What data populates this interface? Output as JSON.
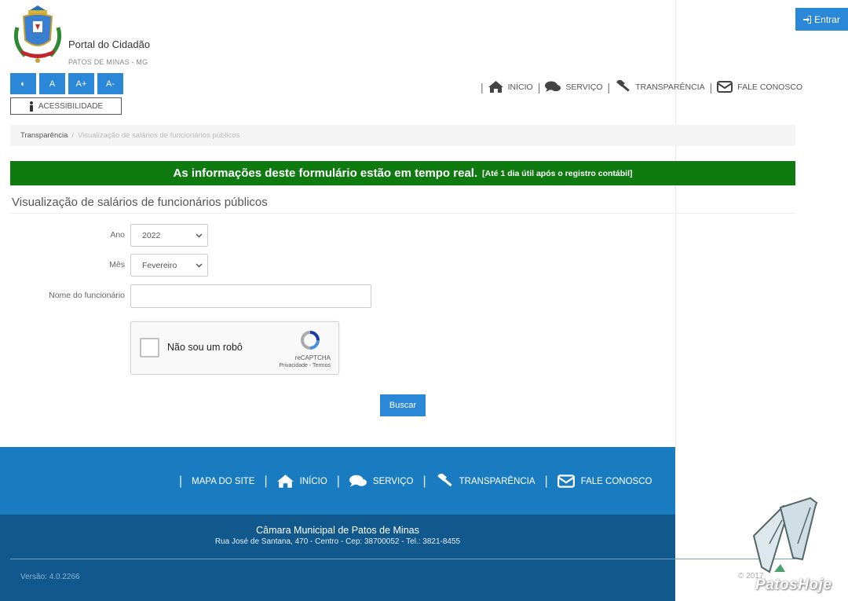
{
  "header": {
    "site_title": "Portal do Cidadão",
    "site_subtitle": "PATOS DE MINAS - MG",
    "login_label": "Entrar"
  },
  "accessibility": {
    "buttons": [
      "◐",
      "A",
      "A+",
      "A-"
    ],
    "label": "ACESSIBILIDADE"
  },
  "top_nav": {
    "items": [
      "INÍCIO",
      "SERVIÇO",
      "TRANSPARÊNCIA",
      "FALE CONOSCO"
    ]
  },
  "breadcrumb": {
    "home": "Transparência",
    "separator": "/",
    "current": "Visualização de salários de funcionários públicos"
  },
  "banner": {
    "main": "As informações deste formulário estão em tempo real.",
    "note": "[Até 1 dia útil após o registro contábil]",
    "color": "#0e7a10"
  },
  "form": {
    "title": "Visualização de salários de funcionários públicos",
    "year_label": "Ano",
    "year_value": "2022",
    "month_label": "Mês",
    "month_value": "Fevereiro",
    "employee_label": "Nome do funcionário",
    "employee_value": "",
    "captcha_text": "Não sou um robô",
    "captcha_brand": "reCAPTCHA",
    "captcha_links": "Privacidade - Termos",
    "search_label": "Buscar"
  },
  "footer": {
    "nav": [
      "MAPA DO SITE",
      "INÍCIO",
      "SERVIÇO",
      "TRANSPARÊNCIA",
      "FALE CONOSCO"
    ],
    "org_name": "Câmara Municipal de Patos de Minas",
    "address": "Rua José de Santana, 470 - Centro - Cep: 38700052 - Tel.: 3821-8455",
    "version": "Versão: 4.0.2266",
    "copyright": "© 2017",
    "watermark": "PatosHoje"
  },
  "colors": {
    "primary": "#2b87d8",
    "footer_top": "#1a7cc0",
    "footer_bottom": "#11588c"
  }
}
